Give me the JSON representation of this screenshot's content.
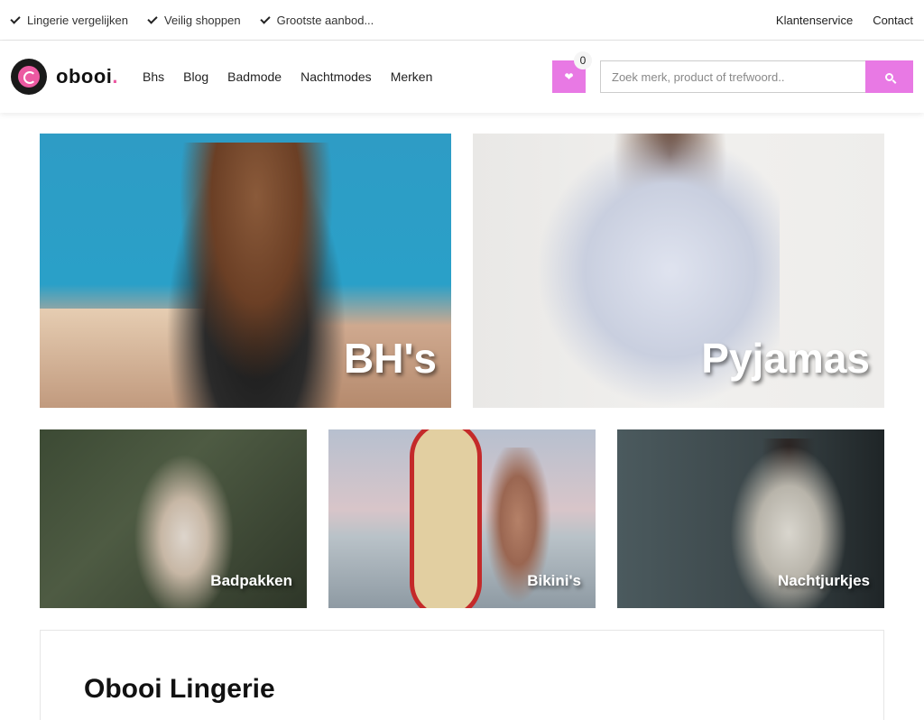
{
  "topbar": {
    "usps": [
      "Lingerie vergelijken",
      "Veilig shoppen",
      "Grootste aanbod..."
    ],
    "links": [
      "Klantenservice",
      "Contact"
    ]
  },
  "header": {
    "logo_text": "obooi",
    "logo_dot": ".",
    "nav": [
      "Bhs",
      "Blog",
      "Badmode",
      "Nachtmodes",
      "Merken"
    ],
    "wishlist_count": "0",
    "search_placeholder": "Zoek merk, product of trefwoord.."
  },
  "tiles": {
    "bhs": "BH's",
    "pyjamas": "Pyjamas",
    "badpakken": "Badpakken",
    "bikinis": "Bikini's",
    "nachtjurkjes": "Nachtjurkjes"
  },
  "content": {
    "title": "Obooi Lingerie"
  },
  "colors": {
    "accent": "#e879e4",
    "brand_pink": "#ec5aa2"
  },
  "icons": {
    "usp": "check-icon",
    "wishlist": "heart-icon",
    "search": "search-icon"
  }
}
